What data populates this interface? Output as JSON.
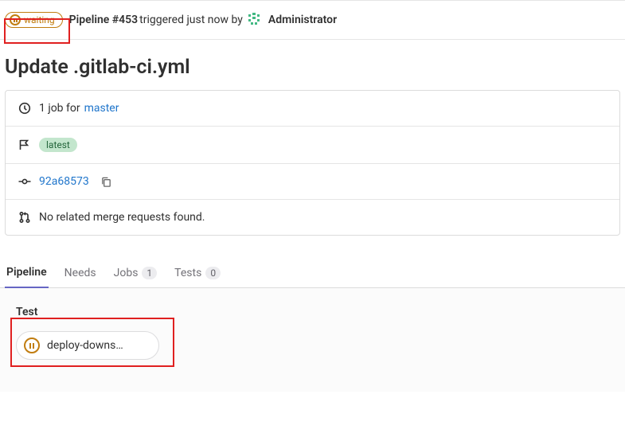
{
  "header": {
    "status": "waiting",
    "pipeline_text": "Pipeline #453",
    "triggered_text": " triggered just now by ",
    "user": "Administrator"
  },
  "title": "Update .gitlab-ci.yml",
  "info": {
    "jobs_text": "1 job for",
    "branch": "master",
    "latest_label": "latest",
    "sha": "92a68573",
    "mr_text": "No related merge requests found."
  },
  "tabs": {
    "pipeline": "Pipeline",
    "needs": "Needs",
    "jobs": "Jobs",
    "jobs_count": "1",
    "tests": "Tests",
    "tests_count": "0"
  },
  "stage": {
    "name": "Test",
    "job_name": "deploy-downs…"
  }
}
